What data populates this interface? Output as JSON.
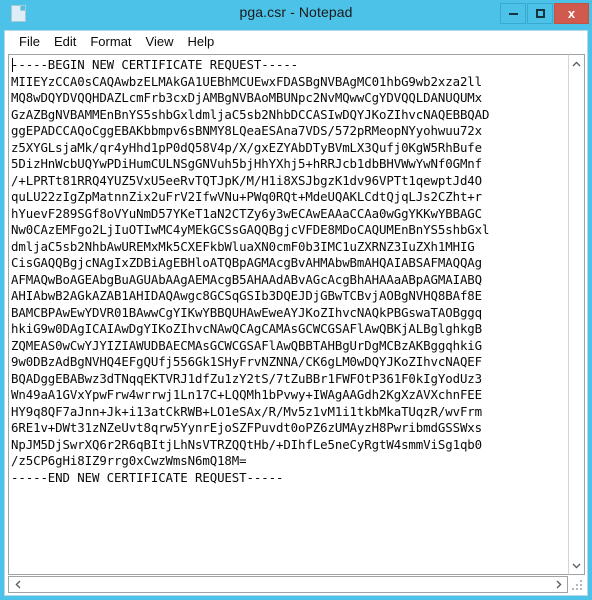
{
  "window": {
    "title": "pga.csr - Notepad",
    "icon": "notepad-document-icon",
    "accent_color": "#4cc2e8",
    "close_color": "#d05a4e",
    "buttons": {
      "minimize": "minimize-icon",
      "maximize": "maximize-icon",
      "close_label": "x"
    }
  },
  "menu": {
    "items": [
      {
        "label": "File"
      },
      {
        "label": "Edit"
      },
      {
        "label": "Format"
      },
      {
        "label": "View"
      },
      {
        "label": "Help"
      }
    ]
  },
  "editor": {
    "caret_visible": true,
    "wrap": false,
    "content": "-----BEGIN NEW CERTIFICATE REQUEST-----\nMIIEYzCCA0sCAQAwbzELMAkGA1UEBhMCUEwxFDASBgNVBAgMC01hbG9wb2xza2ll\nMQ8wDQYDVQQHDAZLcmFrb3cxDjAMBgNVBAoMBUNpc2NvMQwwCgYDVQQLDANUQUMx\nGzAZBgNVBAMMEnBnYS5shbGxldmljaC5sb2NhbDCCASIwDQYJKoZIhvcNAQEBBQAD\nggEPADCCAQoCggEBAKbbmpv6sBNMY8LQeaESAna7VDS/572pRMeopNYyohwuu72x\nz5XYGLsjaMk/qr4yHhd1pP0dQ58V4p/X/gxEZYAbDTyBVmLX3Qufj0KgW5RhBufe\n5DizHnWcbUQYwPDiHumCULNSgGNVuh5bjHhYXhj5+hRRJcb1dbBHVWwYwNf0GMnf\n/+LPRTt81RRQ4YUZ5VxU5eeRvTQTJpK/M/H1i8XSJbgzK1dv96VPTt1qewptJd4O\nquLU22zIgZpMatnnZix2uFrV2IfwVNu+PWq0RQt+MdeUQAKLCdtQjqLJs2CZht+r\nhYuevF289SGf8oVYuNmD57YKeT1aN2CTZy6y3wECAwEAAaCCAa0wGgYKKwYBBAGC\nNw0CAzEMFgo2LjIuOTIwMC4yMEkGCSsGAQQBgjcVFDE8MDoCAQUMEnBnYS5shbGxl\ndmljaC5sb2NhbAwUREMxMk5CXEFkbWluaXN0cmF0b3IMC1uZXRNZ3IuZXh1MHIG\nCisGAQQBgjcNAgIxZDBiAgEBHloATQBpAGMAcgBvAHMAbwBmAHQAIABSAFMAQQAg\nAFMAQwBoAGEAbgBuAGUAbAAgAEMAcgB5AHAAdABvAGcAcgBhAHAAaABpAGMAIABQ\nAHIAbwB2AGkAZAB1AHIDAQAwgc8GCSqGSIb3DQEJDjGBwTCBvjAOBgNVHQ8BAf8E\nBAMCBPAwEwYDVR01BAwwCgYIKwYBBQUHAwEweAYJKoZIhvcNAQkPBGswaTAOBggq\nhkiG9w0DAgICAIAwDgYIKoZIhvcNAwQCAgCAMAsGCWCGSAFlAwQBKjALBglghkgB\nZQMEAS0wCwYJYIZIAWUDBAECMAsGCWCGSAFlAwQBBTAHBgUrDgMCBzAKBggqhkiG\n9w0DBzAdBgNVHQ4EFgQUfj556Gk1SHyFrvNZNNA/CK6gLM0wDQYJKoZIhvcNAQEF\nBQADggEBABwz3dTNqqEKTVRJ1dfZu1zY2tS/7tZuBBr1FWFOtP361F0kIgYodUz3\nWn49aA1GVxYpwFrw4wrrwj1Ln17C+LQQMh1bPvwy+IWAgAAGdh2KgXzAVXchnFEE\nHY9q8QF7aJnn+Jk+i13atCkRWB+LO1eSAx/R/Mv5z1vM1i1tkbMkaTUqzR/wvFrm\n6RE1v+DWt31zNZeUvt8qrw5YynrEjoSZFPuvdt0oPZ6zUMAyzH8PwribmdGSSWxs\nNpJM5DjSwrXQ6r2R6qBItjLhNsVTRZQQtHb/+DIhfLe5neCyRgtW4smmViSg1qb0\n/z5CP6gHi8IZ9rrg0xCwzWmsN6mQ18M=\n-----END NEW CERTIFICATE REQUEST-----"
  },
  "scrollbars": {
    "vertical": {
      "up_arrow": "chevron-up-icon",
      "down_arrow": "chevron-down-icon",
      "thumb_visible": false
    },
    "horizontal": {
      "left_arrow": "chevron-left-icon",
      "right_arrow": "chevron-right-icon",
      "thumb_visible": false
    },
    "resize_grip": "resize-grip-icon"
  }
}
